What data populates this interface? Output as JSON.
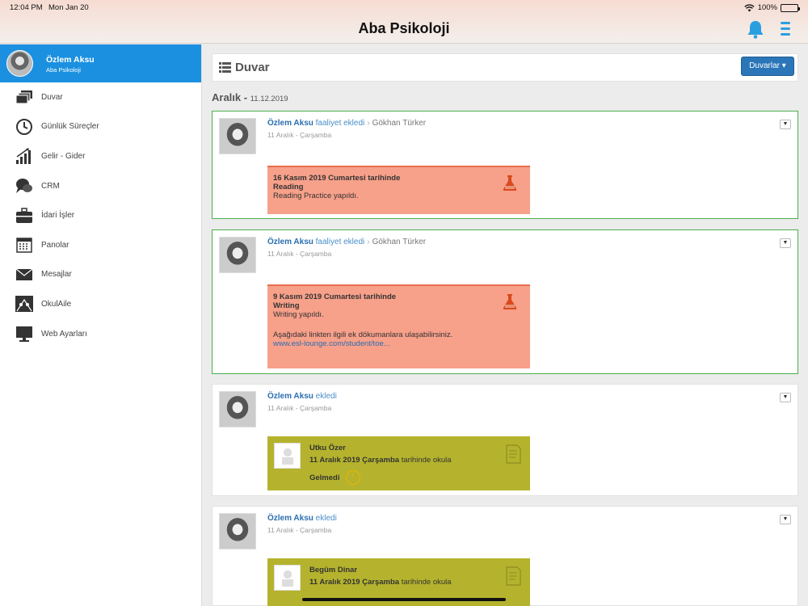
{
  "status_bar": {
    "time": "12:04 PM",
    "date": "Mon Jan 20",
    "battery": "100%",
    "battery_level": 1.0
  },
  "header": {
    "title": "Aba Psikoloji",
    "icons": [
      "bell-icon",
      "menu-icon"
    ],
    "accent": "#2a9fe0"
  },
  "sidebar": {
    "profile": {
      "name": "Özlem Aksu",
      "org": "Aba Psikoloji",
      "bg": "#1b90e0"
    },
    "items": [
      {
        "label": "Duvar",
        "icon": "wall-icon"
      },
      {
        "label": "Günlük Süreçler",
        "icon": "clock-icon"
      },
      {
        "label": "Gelir - Gider",
        "icon": "growth-chart-icon"
      },
      {
        "label": "CRM",
        "icon": "chat-icon"
      },
      {
        "label": "İdari İşler",
        "icon": "briefcase-icon"
      },
      {
        "label": "Panolar",
        "icon": "calendar-icon"
      },
      {
        "label": "Mesajlar",
        "icon": "envelope-icon"
      },
      {
        "label": "OkulAile",
        "icon": "family-icon"
      },
      {
        "label": "Web Ayarları",
        "icon": "monitor-icon"
      }
    ]
  },
  "main": {
    "title": "Duvar",
    "dropdown_label": "Duvarlar",
    "section": {
      "month": "Aralık -",
      "date": "11.12.2019"
    },
    "posts": [
      {
        "author": "Özlem Aksu",
        "action": "faaliyet ekledi",
        "target": "Gökhan Türker",
        "date": "11 Aralık - Çarşamba",
        "card": {
          "line1": "16 Kasım 2019 Cumartesi tarihinde",
          "line2": "Reading",
          "line3": "Reading Practice yapıldı."
        }
      },
      {
        "author": "Özlem Aksu",
        "action": "faaliyet ekledi",
        "target": "Gökhan Türker",
        "date": "11 Aralık - Çarşamba",
        "card": {
          "line1": "9 Kasım 2019 Cumartesi tarihinde",
          "line2": "Writing",
          "line3": "Writing yapıldı.",
          "line4": "Aşağıdaki linkten ilgili ek dökumanlara ulaşabilirsiniz.",
          "link": "www.esl-lounge.com/student/toe..."
        }
      },
      {
        "author": "Özlem Aksu",
        "action": "ekledi",
        "date": "11 Aralık - Çarşamba",
        "card": {
          "name": "Utku Özer",
          "date_bold": "11 Aralık 2019 Çarşamba",
          "date_rest": " tarihinde okula",
          "status": "Gelmedi"
        }
      },
      {
        "author": "Özlem Aksu",
        "action": "ekledi",
        "date": "11 Aralık - Çarşamba",
        "card": {
          "name": "Begüm Dinar",
          "date_bold": "11 Aralık 2019 Çarşamba",
          "date_rest": " tarihinde okula"
        }
      }
    ]
  },
  "colors": {
    "activity_card": "#f7a08a",
    "attendance_card": "#b5b32d",
    "green_border": "#4caf50",
    "button": "#2a76b8"
  }
}
